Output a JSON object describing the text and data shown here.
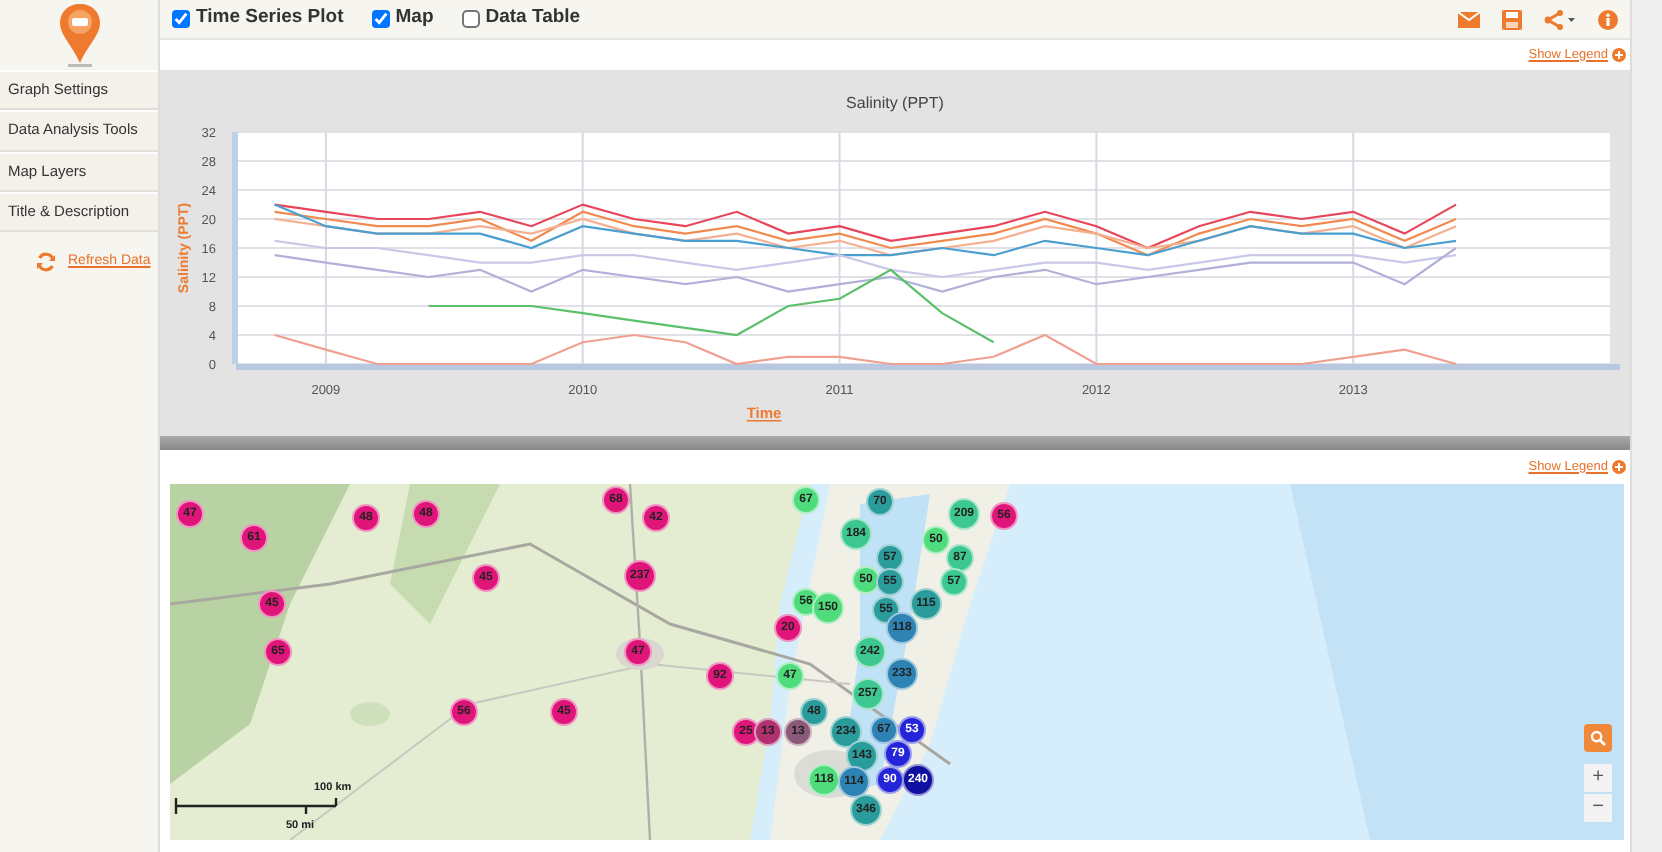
{
  "toolbar": {
    "views": [
      {
        "label": "Time Series Plot",
        "checked": true
      },
      {
        "label": "Map",
        "checked": true
      },
      {
        "label": "Data Table",
        "checked": false
      }
    ]
  },
  "sidebar": {
    "items": [
      {
        "label": "Graph Settings"
      },
      {
        "label": "Data Analysis Tools"
      },
      {
        "label": "Map Layers"
      },
      {
        "label": "Title & Description"
      }
    ],
    "refresh_link": "Refresh Data"
  },
  "chart_panel": {
    "legend_toggle": "Show Legend",
    "chart_data": {
      "type": "line",
      "title": "Salinity (PPT)",
      "xlabel": "Time",
      "ylabel": "Salinity (PPT)",
      "grid": true,
      "x": [
        2008.8,
        2009.0,
        2009.2,
        2009.4,
        2009.6,
        2009.8,
        2010.0,
        2010.2,
        2010.4,
        2010.6,
        2010.8,
        2011.0,
        2011.2,
        2011.4,
        2011.6,
        2011.8,
        2012.0,
        2012.2,
        2012.4,
        2012.6,
        2012.8,
        2013.0,
        2013.2,
        2013.4
      ],
      "xlim": [
        2008.65,
        2014.0
      ],
      "ylim": [
        0,
        32
      ],
      "xticks": [
        2009,
        2010,
        2011,
        2012,
        2013
      ],
      "yticks": [
        0,
        4,
        8,
        12,
        16,
        20,
        24,
        28,
        32
      ],
      "series": [
        {
          "color": "#e8455a",
          "values": [
            22,
            21,
            20,
            20,
            21,
            19,
            22,
            20,
            19,
            21,
            18,
            19,
            17,
            18,
            19,
            21,
            19,
            16,
            19,
            21,
            20,
            21,
            18,
            22
          ]
        },
        {
          "color": "#f08a50",
          "values": [
            21,
            20,
            19,
            19,
            20,
            17,
            21,
            19,
            18,
            19,
            17,
            18,
            16,
            17,
            18,
            20,
            18,
            15,
            18,
            20,
            19,
            20,
            17,
            20
          ]
        },
        {
          "color": "#f4b090",
          "values": [
            20,
            19,
            18,
            18,
            19,
            18,
            20,
            18,
            17,
            18,
            16,
            17,
            15,
            16,
            17,
            19,
            18,
            16,
            17,
            19,
            18,
            19,
            16,
            19
          ]
        },
        {
          "color": "#4a9fd0",
          "values": [
            22,
            19,
            18,
            18,
            18,
            16,
            19,
            18,
            17,
            17,
            16,
            15,
            15,
            16,
            15,
            17,
            16,
            15,
            17,
            19,
            18,
            18,
            16,
            17
          ]
        },
        {
          "color": "#c8c8e8",
          "values": [
            17,
            16,
            16,
            15,
            14,
            14,
            15,
            15,
            14,
            13,
            14,
            15,
            13,
            12,
            13,
            14,
            14,
            13,
            14,
            15,
            15,
            15,
            14,
            15
          ]
        },
        {
          "color": "#b0b0d8",
          "values": [
            15,
            14,
            13,
            12,
            13,
            10,
            13,
            12,
            11,
            12,
            10,
            11,
            12,
            10,
            12,
            13,
            11,
            12,
            13,
            14,
            14,
            14,
            11,
            16
          ]
        },
        {
          "color": "#5cbf6a",
          "values": [
            null,
            null,
            null,
            8,
            8,
            8,
            7,
            6,
            5,
            4,
            8,
            9,
            13,
            7,
            3,
            null,
            null,
            null,
            null,
            null,
            null,
            null,
            null,
            null
          ]
        },
        {
          "color": "#f0a090",
          "values": [
            4,
            2,
            0,
            0,
            0,
            0,
            3,
            4,
            3,
            0,
            1,
            1,
            0,
            0,
            1,
            4,
            0,
            0,
            0,
            0,
            0,
            1,
            2,
            0
          ]
        }
      ]
    }
  },
  "map_panel": {
    "legend_toggle": "Show Legend",
    "clusters": [
      {
        "label": "68",
        "color": "#e0157a"
      },
      {
        "label": "67",
        "color": "#4fdc7c"
      },
      {
        "label": "70",
        "color": "#2a9c9c"
      },
      {
        "label": "47",
        "color": "#e0157a"
      },
      {
        "label": "48",
        "color": "#e0157a"
      },
      {
        "label": "48",
        "color": "#e0157a"
      },
      {
        "label": "42",
        "color": "#e0157a"
      },
      {
        "label": "209",
        "color": "#3cc890"
      },
      {
        "label": "56",
        "color": "#e0157a"
      },
      {
        "label": "61",
        "color": "#e0157a"
      },
      {
        "label": "184",
        "color": "#3cc890"
      },
      {
        "label": "50",
        "color": "#4fdc7c"
      },
      {
        "label": "57",
        "color": "#2a9c9c"
      },
      {
        "label": "87",
        "color": "#3cc890"
      },
      {
        "label": "45",
        "color": "#e0157a"
      },
      {
        "label": "237",
        "color": "#e0157a"
      },
      {
        "label": "50",
        "color": "#4fdc7c"
      },
      {
        "label": "55",
        "color": "#2a9c9c"
      },
      {
        "label": "57",
        "color": "#3cc890"
      },
      {
        "label": "45",
        "color": "#e0157a"
      },
      {
        "label": "56",
        "color": "#4fdc7c"
      },
      {
        "label": "150",
        "color": "#4fdc7c"
      },
      {
        "label": "55",
        "color": "#2a9c9c"
      },
      {
        "label": "115",
        "color": "#2a9c9c"
      },
      {
        "label": "20",
        "color": "#e0157a"
      },
      {
        "label": "118",
        "color": "#2d84b4"
      },
      {
        "label": "65",
        "color": "#e0157a"
      },
      {
        "label": "47",
        "color": "#e0157a"
      },
      {
        "label": "242",
        "color": "#3cc890"
      },
      {
        "label": "92",
        "color": "#e0157a"
      },
      {
        "label": "47",
        "color": "#4fdc7c"
      },
      {
        "label": "233",
        "color": "#2d84b4"
      },
      {
        "label": "257",
        "color": "#3cc890"
      },
      {
        "label": "56",
        "color": "#e0157a"
      },
      {
        "label": "45",
        "color": "#e0157a"
      },
      {
        "label": "48",
        "color": "#2a9c9c"
      },
      {
        "label": "25",
        "color": "#e0157a"
      },
      {
        "label": "13",
        "color": "#b03070"
      },
      {
        "label": "13",
        "color": "#8c5a78"
      },
      {
        "label": "234",
        "color": "#2a9c9c"
      },
      {
        "label": "67",
        "color": "#2d84b4"
      },
      {
        "label": "53",
        "color": "#2424d8"
      },
      {
        "label": "143",
        "color": "#2a9c9c"
      },
      {
        "label": "79",
        "color": "#2424d8"
      },
      {
        "label": "118",
        "color": "#4fdc7c"
      },
      {
        "label": "114",
        "color": "#2d84b4"
      },
      {
        "label": "90",
        "color": "#2424d8"
      },
      {
        "label": "240",
        "color": "#1010a0"
      },
      {
        "label": "346",
        "color": "#2a9c9c"
      }
    ],
    "scale_bar": {
      "km": "100 km",
      "mi": "50 mi"
    },
    "zoom_in": "+",
    "zoom_out": "−"
  }
}
